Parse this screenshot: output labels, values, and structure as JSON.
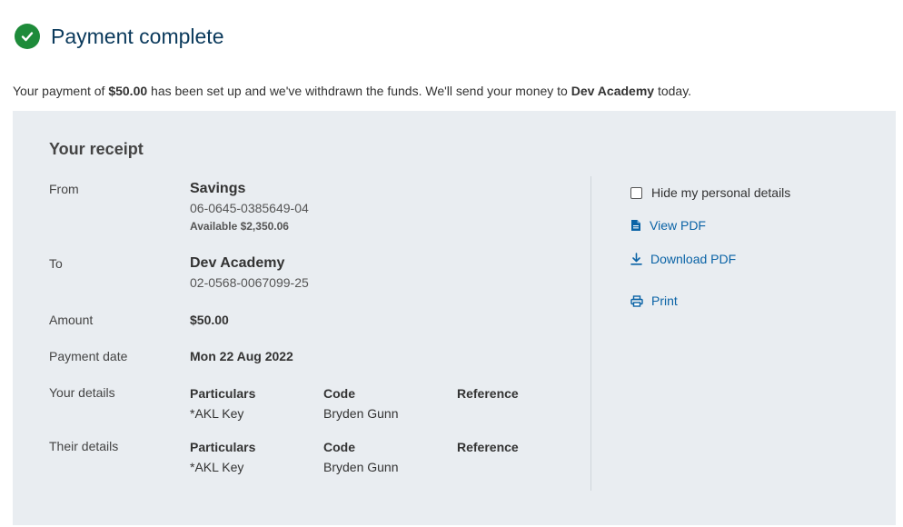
{
  "header": {
    "title": "Payment complete",
    "icon": "check-circle-icon",
    "accent_color": "#1e8b3a"
  },
  "summary": {
    "prefix": "Your payment of ",
    "amount": "$50.00",
    "middle": " has been set up and we've withdrawn the funds. We'll send your money to ",
    "payee": "Dev Academy",
    "suffix": " today."
  },
  "receipt": {
    "title": "Your receipt",
    "from": {
      "label": "From",
      "account_name": "Savings",
      "account_number": "06-0645-0385649-04",
      "available": "Available $2,350.06"
    },
    "to": {
      "label": "To",
      "account_name": "Dev Academy",
      "account_number": "02-0568-0067099-25"
    },
    "amount": {
      "label": "Amount",
      "value": "$50.00"
    },
    "payment_date": {
      "label": "Payment date",
      "value": "Mon 22 Aug 2022"
    },
    "your_details": {
      "label": "Your details",
      "particulars_label": "Particulars",
      "particulars": "*AKL Key",
      "code_label": "Code",
      "code": "Bryden Gunn",
      "reference_label": "Reference",
      "reference": ""
    },
    "their_details": {
      "label": "Their details",
      "particulars_label": "Particulars",
      "particulars": "*AKL Key",
      "code_label": "Code",
      "code": "Bryden Gunn",
      "reference_label": "Reference",
      "reference": ""
    }
  },
  "actions": {
    "hide_details_label": "Hide my personal details",
    "hide_details_checked": false,
    "view_pdf_label": "View PDF",
    "download_pdf_label": "Download PDF",
    "print_label": "Print",
    "link_color": "#0a63a6"
  }
}
